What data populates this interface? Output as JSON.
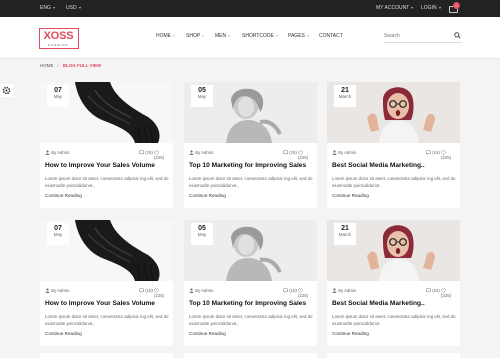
{
  "topbar": {
    "language": "ENG",
    "currency": "USD",
    "account": "MY ACCOUNT",
    "login": "LOGIN",
    "cart_count": "0"
  },
  "logo": {
    "word": "XOSS",
    "sub": "FASHION"
  },
  "nav": [
    "HOME",
    "SHOP",
    "MEN",
    "SHORTCODE",
    "PAGES",
    "CONTACT"
  ],
  "search": {
    "placeholder": "Search"
  },
  "breadcrumb": {
    "home": "HOME",
    "separator": "/",
    "current": "BLOG FULL VIEW"
  },
  "posts": [
    {
      "day": "07",
      "month": "May",
      "author": "By Admin",
      "comments": "(15)",
      "likes": "(225)",
      "title": "How to Improve Your Sales Volume",
      "excerpt": "Lorem ipsum dolor sit amet, consectetur adipisic ing elit, sed do eiusmodte poincididunvt..",
      "more": "Continue Reading",
      "image": "scarf"
    },
    {
      "day": "05",
      "month": "May",
      "author": "By Admin",
      "comments": "(15)",
      "likes": "(225)",
      "title": "Top 10 Marketing for Improving Sales",
      "excerpt": "Lorem ipsum dolor sit amet, consectetur adipisic ing elit, sed do eiusmodte poincididunvt..",
      "more": "Continue Reading",
      "image": "woman-bw"
    },
    {
      "day": "21",
      "month": "March",
      "author": "By Admin",
      "comments": "(15)",
      "likes": "(225)",
      "title": "Best Social Media Marketing..",
      "excerpt": "Lorem ipsum dolor sit amet, consectetur adipisic ing elit, sed do eiusmodte poincididunvt..",
      "more": "Continue Reading",
      "image": "woman-surprised"
    },
    {
      "day": "07",
      "month": "May",
      "author": "By Admin",
      "comments": "(15)",
      "likes": "(225)",
      "title": "How to Improve Your Sales Volume",
      "excerpt": "Lorem ipsum dolor sit amet, consectetur adipisic ing elit, sed do eiusmodte poincididunvt..",
      "more": "Continue Reading",
      "image": "scarf"
    },
    {
      "day": "05",
      "month": "May",
      "author": "By Admin",
      "comments": "(15)",
      "likes": "(225)",
      "title": "Top 10 Marketing for Improving Sales",
      "excerpt": "Lorem ipsum dolor sit amet, consectetur adipisic ing elit, sed do eiusmodte poincididunvt..",
      "more": "Continue Reading",
      "image": "woman-bw"
    },
    {
      "day": "21",
      "month": "March",
      "author": "By Admin",
      "comments": "(15)",
      "likes": "(225)",
      "title": "Best Social Media Marketing..",
      "excerpt": "Lorem ipsum dolor sit amet, consectetur adipisic ing elit, sed do eiusmodte poincididunvt..",
      "more": "Continue Reading",
      "image": "woman-surprised"
    }
  ],
  "colors": {
    "accent": "#e24a5b",
    "topbar": "#222222",
    "background": "#f4f4f4"
  }
}
